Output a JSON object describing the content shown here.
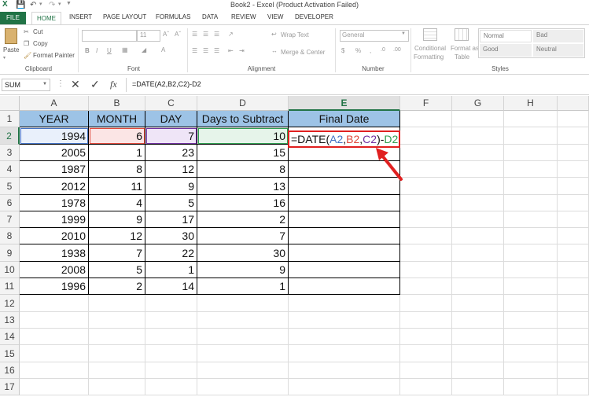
{
  "window": {
    "title": "Book2 - Excel (Product Activation Failed)"
  },
  "tabs": [
    "FILE",
    "HOME",
    "INSERT",
    "PAGE LAYOUT",
    "FORMULAS",
    "DATA",
    "REVIEW",
    "VIEW",
    "DEVELOPER"
  ],
  "ribbon": {
    "clipboard": {
      "paste": "Paste",
      "cut": "Cut",
      "copy": "Copy",
      "format_painter": "Format Painter",
      "label": "Clipboard"
    },
    "font": {
      "size": "11",
      "bold": "B",
      "italic": "I",
      "underline": "U",
      "label": "Font"
    },
    "alignment": {
      "wrap": "Wrap Text",
      "merge": "Merge & Center",
      "label": "Alignment"
    },
    "number": {
      "format": "General",
      "label": "Number"
    },
    "styles": {
      "conditional": "Conditional",
      "formatting": "Formatting",
      "format_as": "Format as",
      "table": "Table",
      "cells": [
        "Normal",
        "Bad",
        "Good",
        "Neutral"
      ],
      "label": "Styles"
    }
  },
  "formula_bar": {
    "name_box": "SUM",
    "fx": "fx",
    "formula": "=DATE(A2,B2,C2)-D2"
  },
  "colors": {
    "excel_green": "#217346",
    "header_fill": "#9dc3e6",
    "ref_a": "#4472c4",
    "ref_b": "#e0473a",
    "ref_c": "#7030a0",
    "ref_d": "#2e9e4f"
  },
  "columns": [
    "A",
    "B",
    "C",
    "D",
    "E",
    "F",
    "G",
    "H"
  ],
  "rows": [
    "1",
    "2",
    "3",
    "4",
    "5",
    "6",
    "7",
    "8",
    "9",
    "10",
    "11",
    "12",
    "13",
    "14",
    "15",
    "16",
    "17"
  ],
  "headers": {
    "a": "YEAR",
    "b": "MONTH",
    "c": "DAY",
    "d": "Days to Subtract",
    "e": "Final Date"
  },
  "data_rows": [
    {
      "year": "1994",
      "month": "6",
      "day": "7",
      "sub": "10"
    },
    {
      "year": "2005",
      "month": "1",
      "day": "23",
      "sub": "15"
    },
    {
      "year": "1987",
      "month": "8",
      "day": "12",
      "sub": "8"
    },
    {
      "year": "2012",
      "month": "11",
      "day": "9",
      "sub": "13"
    },
    {
      "year": "1978",
      "month": "4",
      "day": "5",
      "sub": "16"
    },
    {
      "year": "1999",
      "month": "9",
      "day": "17",
      "sub": "2"
    },
    {
      "year": "2010",
      "month": "12",
      "day": "30",
      "sub": "7"
    },
    {
      "year": "1938",
      "month": "7",
      "day": "22",
      "sub": "30"
    },
    {
      "year": "2008",
      "month": "5",
      "day": "1",
      "sub": "9"
    },
    {
      "year": "1996",
      "month": "2",
      "day": "14",
      "sub": "1"
    }
  ],
  "edit_formula": {
    "prefix": "=DATE(",
    "a": "A2",
    "comma1": ",",
    "b": "B2",
    "comma2": ",",
    "c": "C2",
    "close": ")-",
    "d": "D2"
  }
}
